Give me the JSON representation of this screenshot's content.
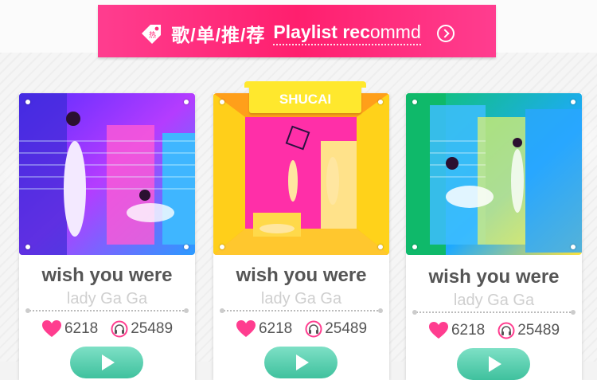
{
  "header": {
    "icon_name": "hot-tag-icon",
    "icon_text": "热",
    "title_zh": "歌/单/推/荐",
    "title_en_bold": "Playlist rec",
    "title_en_light": "ommd",
    "accent_color": "#ff2a7a"
  },
  "badge": {
    "label": "SHUCAI",
    "color": "#ffe82d"
  },
  "cards": [
    {
      "title": "wish you were",
      "artist": "lady Ga Ga",
      "likes": "6218",
      "plays": "25489"
    },
    {
      "title": "wish you were",
      "artist": "lady Ga Ga",
      "likes": "6218",
      "plays": "25489"
    },
    {
      "title": "wish you were",
      "artist": "lady Ga Ga",
      "likes": "6218",
      "plays": "25489"
    }
  ],
  "colors": {
    "like": "#ff3d8f",
    "play_button": "#3fc19e",
    "title": "#555555",
    "artist": "#cfcfcf"
  }
}
